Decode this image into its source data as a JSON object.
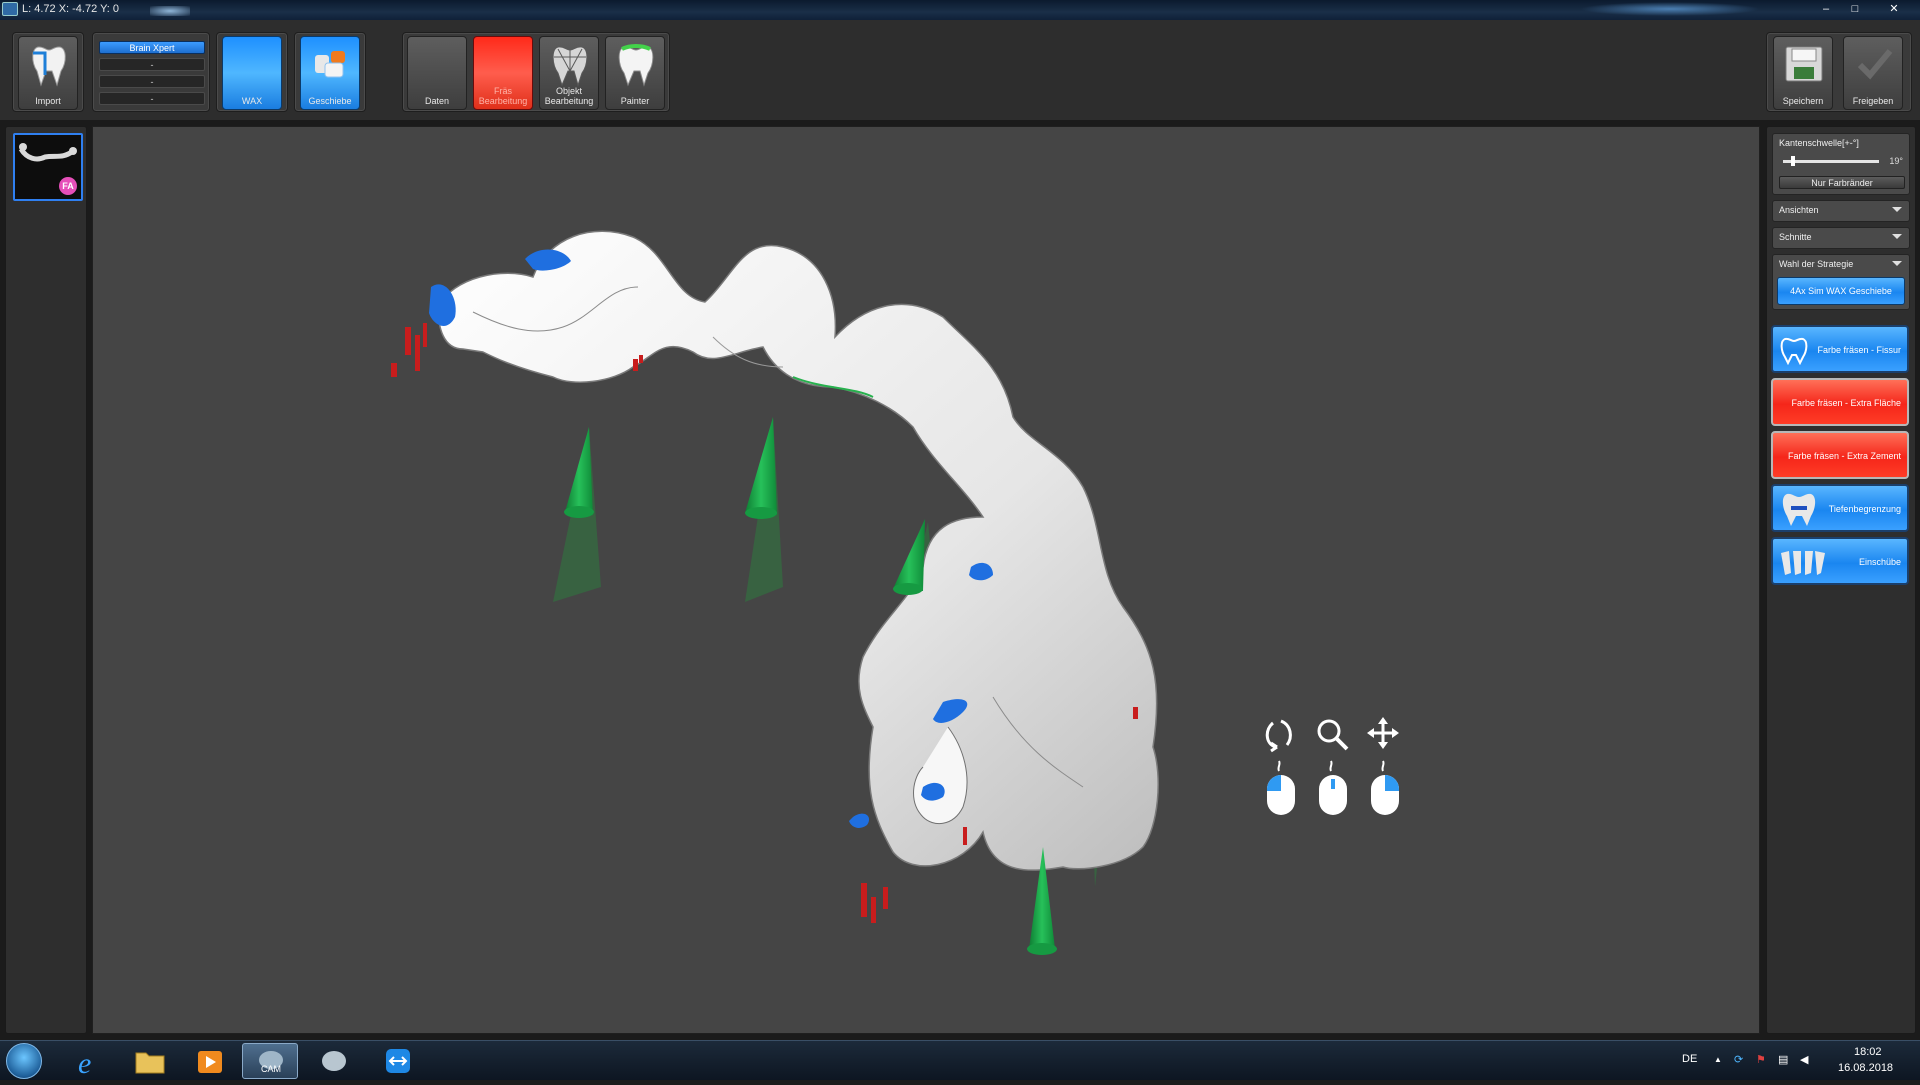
{
  "titlebar": {
    "title": "L: 4.72 X: -4.72 Y: 0",
    "controls": [
      "–",
      "□",
      "✕"
    ]
  },
  "toolbar": {
    "import_label": "Import",
    "brain": {
      "active": "Brain Xpert",
      "slots": [
        "-",
        "-",
        "-"
      ]
    },
    "wax_label": "WAX",
    "geschiebe_label": "Geschiebe",
    "daten_label": "Daten",
    "frasbearbeitung_label": "Fräs Bearbeitung",
    "objekt_label": "Objekt Bearbeitung",
    "painter_label": "Painter",
    "speichern_label": "Speichern",
    "freigeben_label": "Freigeben"
  },
  "left_panel": {
    "thumbnail_badge": "FA"
  },
  "right_panel": {
    "kantenschwelle": {
      "label": "Kantenschwelle[+-°]",
      "value": "19°",
      "button": "Nur Farbränder",
      "level_fraction": 0.1
    },
    "ansichten": "Ansichten",
    "schnitte": "Schnitte",
    "strategie": {
      "label": "Wahl der Strategie",
      "button": "4Ax Sim WAX Geschiebe"
    },
    "tools": [
      {
        "label": "Farbe fräsen - Fissur",
        "style": "blue",
        "icon": "tooth-outline-icon"
      },
      {
        "label": "Farbe fräsen - Extra Fläche",
        "style": "red",
        "icon": ""
      },
      {
        "label": "Farbe fräsen - Extra Zement",
        "style": "red",
        "icon": ""
      },
      {
        "label": "Tiefenbegrenzung",
        "style": "blue",
        "icon": "depth-limit-tooth-icon"
      },
      {
        "label": "Einschübe",
        "style": "blue",
        "icon": "insertion-teeth-icon"
      }
    ]
  },
  "viewport": {
    "nav_icons": [
      "rotate-icon",
      "zoom-icon",
      "pan-icon"
    ],
    "mouse_hints": [
      "left-mouse-icon",
      "middle-mouse-icon",
      "right-mouse-icon"
    ]
  },
  "taskbar": {
    "apps": [
      "internet-explorer-icon",
      "folder-icon",
      "media-player-icon",
      "cam-app-icon",
      "mill-app-icon",
      "teamviewer-icon"
    ],
    "cam_label": "CAM",
    "language": "DE",
    "time": "18:02",
    "date": "16.08.2018"
  },
  "colors": {
    "accent_blue": "#1e90ff",
    "accent_red": "#f5261a",
    "viewport_bg": "#454545",
    "support_green": "#1fa44a"
  }
}
